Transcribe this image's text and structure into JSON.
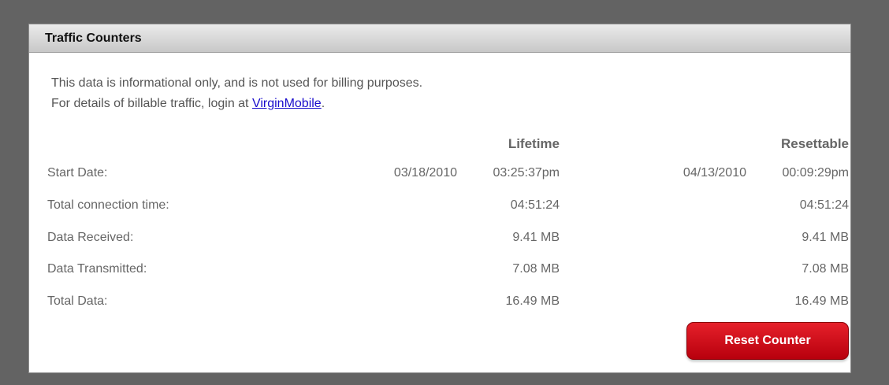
{
  "panel": {
    "title": "Traffic Counters"
  },
  "info": {
    "line1": "This data is informational only, and is not used for billing purposes.",
    "line2_prefix": "For details of billable traffic, login at ",
    "link_text": "VirginMobile",
    "line2_suffix": "."
  },
  "columns": {
    "lifetime": "Lifetime",
    "resettable": "Resettable"
  },
  "rows": {
    "start_date": {
      "label": "Start Date:",
      "lifetime_date": "03/18/2010",
      "lifetime_time": "03:25:37pm",
      "resettable_date": "04/13/2010",
      "resettable_time": "00:09:29pm"
    },
    "connection_time": {
      "label": "Total connection time:",
      "lifetime": "04:51:24",
      "resettable": "04:51:24"
    },
    "data_received": {
      "label": "Data Received:",
      "lifetime": "9.41 MB",
      "resettable": "9.41 MB"
    },
    "data_transmitted": {
      "label": "Data Transmitted:",
      "lifetime": "7.08 MB",
      "resettable": "7.08 MB"
    },
    "total_data": {
      "label": "Total Data:",
      "lifetime": "16.49 MB",
      "resettable": "16.49 MB"
    }
  },
  "buttons": {
    "reset_label": "Reset Counter"
  },
  "colors": {
    "background": "#636363",
    "button_red": "#d0101c",
    "link": "#1a0dcc"
  }
}
